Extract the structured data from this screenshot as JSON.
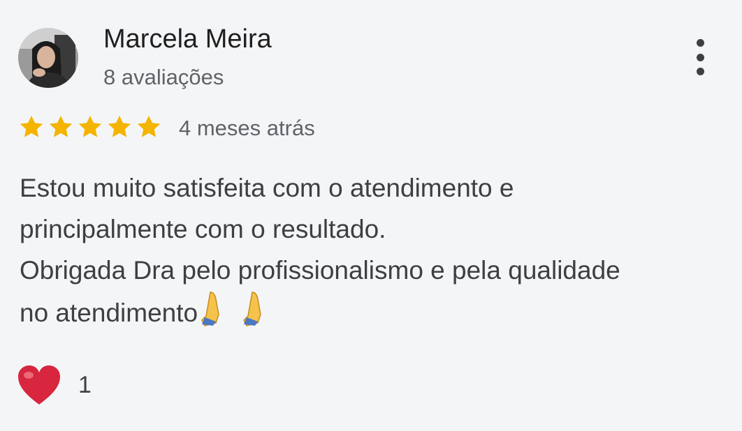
{
  "review": {
    "author_name": "Marcela Meira",
    "author_reviews_count": "8 avaliações",
    "rating": 5,
    "rating_max": 5,
    "time_ago": "4 meses atrás",
    "text_lines": [
      "Estou muito satisfeita com o atendimento e",
      "principalmente com o resultado.",
      "Obrigada Dra pelo profissionalismo e pela qualidade",
      "no atendimento"
    ],
    "text_emoji": "praying-hands-icon x2",
    "reaction": {
      "icon": "heart-icon",
      "count": "1"
    }
  },
  "colors": {
    "star": "#f4b400",
    "background": "#f4f5f7",
    "heart": "#d7263d"
  },
  "icons": {
    "menu": "more-vert-icon"
  }
}
